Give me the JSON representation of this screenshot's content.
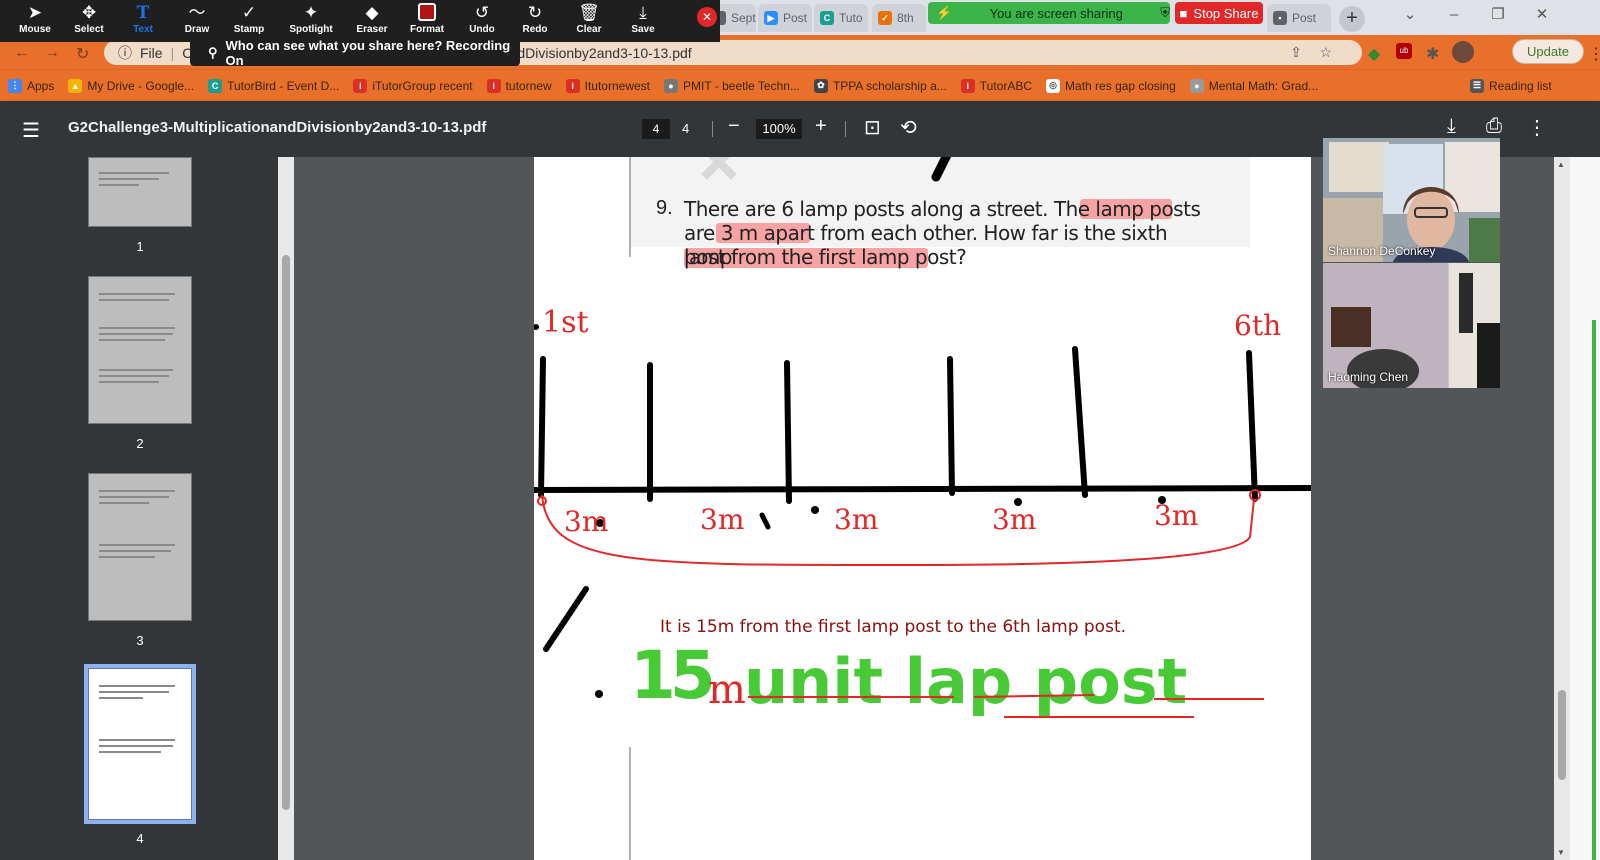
{
  "zoom_toolbar": {
    "tools": [
      {
        "label": "Mouse",
        "icon": "cursor-icon"
      },
      {
        "label": "Select",
        "icon": "move-icon"
      },
      {
        "label": "Text",
        "icon": "text-icon"
      },
      {
        "label": "Draw",
        "icon": "squiggle-icon"
      },
      {
        "label": "Stamp",
        "icon": "check-stamp-icon"
      },
      {
        "label": "Spotlight",
        "icon": "wand-icon"
      },
      {
        "label": "Eraser",
        "icon": "eraser-icon"
      },
      {
        "label": "Format",
        "icon": "color-square-icon"
      },
      {
        "label": "Undo",
        "icon": "undo-icon"
      },
      {
        "label": "Redo",
        "icon": "redo-icon"
      },
      {
        "label": "Clear",
        "icon": "trash-icon"
      },
      {
        "label": "Save",
        "icon": "download-icon"
      }
    ],
    "active_tool": "Text",
    "recording_tooltip": "Who can see what you share here? Recording On",
    "format_color": "#b01414"
  },
  "sharing": {
    "status": "You are screen sharing",
    "stop_label": "Stop Share"
  },
  "tabs": [
    {
      "title": "Sept",
      "icon_color": "#5f6368"
    },
    {
      "title": "Post",
      "icon_color": "#2d8cff"
    },
    {
      "title": "Tuto",
      "icon_color": "#1a9e8f"
    },
    {
      "title": "8th",
      "icon_color": "#e8710a"
    },
    {
      "title": "Post",
      "icon_color": "#5f6368"
    }
  ],
  "address_bar": {
    "file_label": "File",
    "url_visible": "onandDivisionby2and3-10-13.pdf",
    "url_prefix": "C:",
    "update_label": "Update"
  },
  "bookmarks": [
    {
      "label": "Apps",
      "color": "#4285f4"
    },
    {
      "label": "My Drive - Google...",
      "color": "#f4b400"
    },
    {
      "label": "TutorBird - Event D...",
      "color": "#1a9e8f"
    },
    {
      "label": "iTutorGroup recent",
      "color": "#d93025"
    },
    {
      "label": "tutornew",
      "color": "#d93025"
    },
    {
      "label": "Itutornewest",
      "color": "#d93025"
    },
    {
      "label": "PMIT - beetle Techn...",
      "color": "#777777"
    },
    {
      "label": "TPPA scholarship a...",
      "color": "#444444"
    },
    {
      "label": "TutorABC",
      "color": "#d93025"
    },
    {
      "label": "Math res gap closing",
      "color": "#ffffff"
    },
    {
      "label": "Mental Math: Grad...",
      "color": "#999999"
    },
    {
      "label": "Reading list",
      "color": "#555555"
    }
  ],
  "pdf": {
    "filename": "G2Challenge3-MultiplicationandDivisionby2and3-10-13.pdf",
    "current_page": "4",
    "total_pages": "4",
    "zoom": "100%",
    "thumbnail_labels": [
      "1",
      "2",
      "3",
      "4"
    ],
    "selected_page": 4
  },
  "problem": {
    "number": "9.",
    "lines": [
      "There are 6 lamp posts along a street. The lamp posts",
      "are 3 m apart from each other. How far is the sixth lamp",
      "post from the first lamp post?"
    ],
    "highlights": [
      "3 m apart",
      "sixth lamp",
      "post from the first lamp post"
    ]
  },
  "annotations": {
    "first_label": "1st",
    "sixth_label": "6th",
    "gap_labels": [
      "3m",
      "3m",
      "3m",
      "3m",
      "3m"
    ],
    "answer_sentence": "It is 15m from the first lamp post to the 6th lamp post.",
    "big_number": "15",
    "big_unit": "m",
    "big_words": "unit lap post",
    "ink_black": "#000000",
    "ink_red": "#e02828",
    "ink_green": "#48c936"
  },
  "participants": [
    {
      "name": "Shannon DeConkey"
    },
    {
      "name": "Haoming Chen"
    }
  ]
}
